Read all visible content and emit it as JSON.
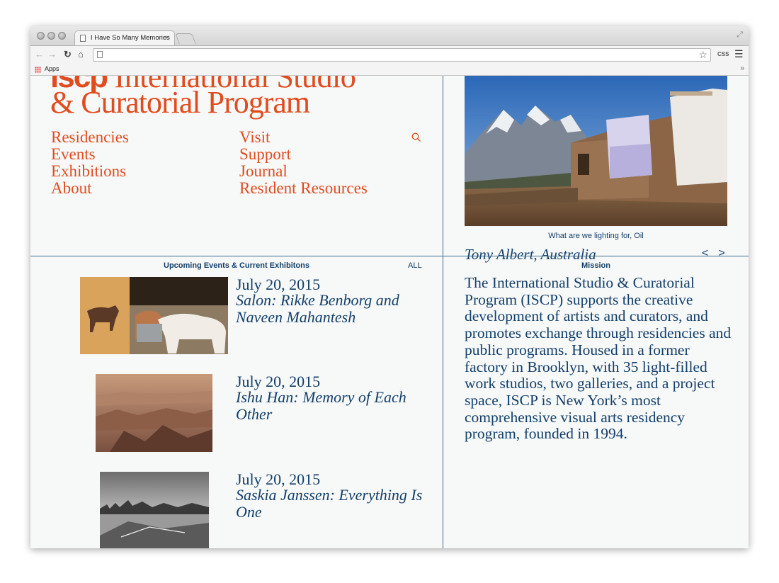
{
  "browser": {
    "tab_title": "I Have So Many Memories",
    "tab_close": "×",
    "bookmarks_apps": "Apps",
    "ext_css": "CSS",
    "bookmarks_more": "»"
  },
  "logo": {
    "acronym": "iscp",
    "line1": "International Studio",
    "line2": "& Curatorial Program"
  },
  "nav": {
    "left": [
      "Residencies",
      "Events",
      "Exhibitions",
      "About"
    ],
    "right": [
      "Visit",
      "Support",
      "Journal",
      "Resident Resources"
    ]
  },
  "hero": {
    "caption": "What are we lighting for, Oil",
    "slide_title": "Tony Albert, Australia",
    "prev": "<",
    "next": ">"
  },
  "events_section": {
    "label": "Upcoming Events & Current Exhibitons",
    "all_label": "ALL",
    "items": [
      {
        "date": "July 20, 2015",
        "title": "Salon: Rikke Benborg and Naveen Mahantesh"
      },
      {
        "date": "July 20, 2015",
        "title": "Ishu Han: Memory of Each Other"
      },
      {
        "date": "July 20, 2015",
        "title": "Saskia Janssen: Everything Is One"
      }
    ]
  },
  "mission": {
    "label": "Mission",
    "text": "The International Studio & Curatorial Program (ISCP) supports the creative development of artists and curators, and promotes exchange through residencies and public programs. Housed in a former factory in Brooklyn, with 35 light-filled work studios, two galleries, and a project space, ISCP is New York’s most comprehensive visual arts residency program, founded in 1994."
  },
  "colors": {
    "accent_orange": "#e14c1f",
    "text_blue": "#13406a",
    "divider": "#3f6d8c"
  }
}
